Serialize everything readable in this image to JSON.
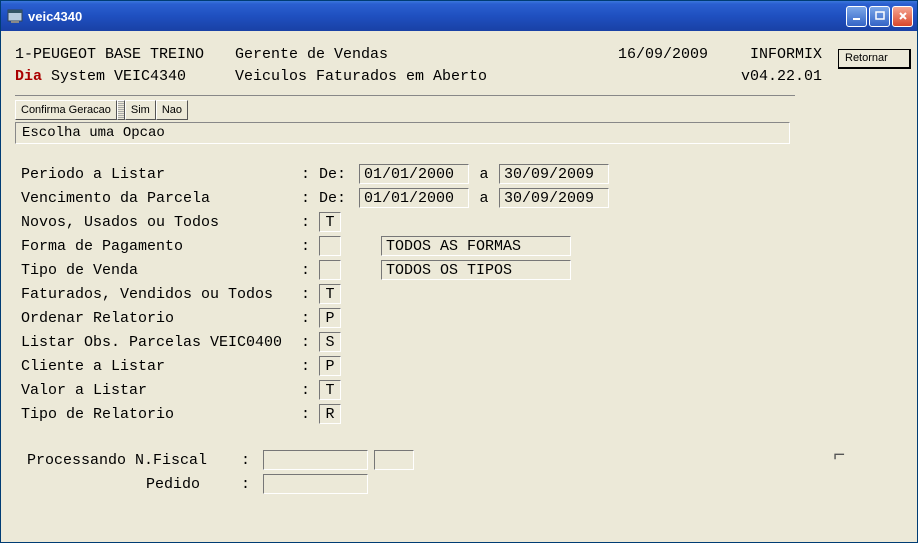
{
  "window": {
    "title": "veic4340"
  },
  "sidebar": {
    "retornar": "Retornar"
  },
  "header": {
    "line1": {
      "company": "1-PEUGEOT BASE TREINO",
      "role": "Gerente de Vendas",
      "date": "16/09/2009",
      "db": "INFORMIX"
    },
    "line2": {
      "dia": "Dia",
      "system": " System  VEIC4340",
      "screen": "Veiculos Faturados em Aberto",
      "version": "v04.22.01"
    }
  },
  "toolbar": {
    "confirma": "Confirma Geracao",
    "sim": "Sim",
    "nao": "Nao"
  },
  "status": "Escolha uma Opcao",
  "form": {
    "periodo": {
      "label": "Periodo a Listar",
      "de": "De:",
      "from": "01/01/2000",
      "a": "a",
      "to": "30/09/2009"
    },
    "vencimento": {
      "label": "Vencimento da Parcela",
      "de": "De:",
      "from": "01/01/2000",
      "a": "a",
      "to": "30/09/2009"
    },
    "novos": {
      "label": "Novos, Usados ou Todos",
      "value": "T"
    },
    "forma": {
      "label": "Forma de Pagamento",
      "code": "",
      "desc": "TODOS AS FORMAS"
    },
    "tipo_venda": {
      "label": "Tipo de Venda",
      "code": "",
      "desc": "TODOS OS TIPOS"
    },
    "faturados": {
      "label": "Faturados, Vendidos ou Todos",
      "value": "T"
    },
    "ordenar": {
      "label": "Ordenar Relatorio",
      "value": "P"
    },
    "listar_obs": {
      "label": "Listar Obs. Parcelas VEIC0400",
      "value": "S"
    },
    "cliente": {
      "label": "Cliente a Listar",
      "value": "P"
    },
    "valor": {
      "label": "Valor a Listar",
      "value": "T"
    },
    "tipo_rel": {
      "label": "Tipo de Relatorio",
      "value": "R"
    },
    "processando": {
      "label": "Processando N.Fiscal",
      "v1": "",
      "v2": ""
    },
    "pedido": {
      "label": "Pedido",
      "value": ""
    }
  },
  "labels": {
    "colon": ":"
  }
}
